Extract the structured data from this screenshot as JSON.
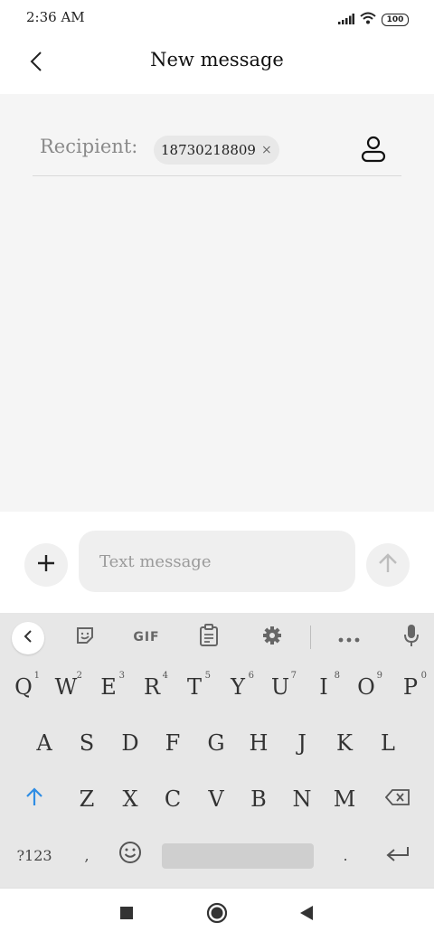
{
  "status_bar": {
    "time": "2:36 AM",
    "battery": "100",
    "icons": [
      "signal-icon",
      "wifi-icon",
      "battery-icon"
    ]
  },
  "header": {
    "title": "New message",
    "back_icon": "back-arrow-icon"
  },
  "recipient": {
    "label": "Recipient:",
    "chip_number": "18730218809",
    "chip_remove": "×",
    "contact_icon": "contact-icon"
  },
  "compose": {
    "placeholder": "Text message",
    "value": "",
    "add_icon": "plus-icon",
    "send_icon": "send-arrow-icon"
  },
  "keyboard": {
    "toolbar": {
      "gif_label": "GIF",
      "icons": [
        "collapse-icon",
        "sticker-icon",
        "gif-icon",
        "clipboard-icon",
        "settings-icon",
        "more-icon",
        "mic-icon"
      ]
    },
    "row1": [
      {
        "key": "Q",
        "hint": "1"
      },
      {
        "key": "W",
        "hint": "2"
      },
      {
        "key": "E",
        "hint": "3"
      },
      {
        "key": "R",
        "hint": "4"
      },
      {
        "key": "T",
        "hint": "5"
      },
      {
        "key": "Y",
        "hint": "6"
      },
      {
        "key": "U",
        "hint": "7"
      },
      {
        "key": "I",
        "hint": "8"
      },
      {
        "key": "O",
        "hint": "9"
      },
      {
        "key": "P",
        "hint": "0"
      }
    ],
    "row2": [
      "A",
      "S",
      "D",
      "F",
      "G",
      "H",
      "J",
      "K",
      "L"
    ],
    "row3": [
      "Z",
      "X",
      "C",
      "V",
      "B",
      "N",
      "M"
    ],
    "row4": {
      "symbols": "?123",
      "comma": ",",
      "period": "."
    },
    "accent_color": "#2f8de4"
  },
  "colors": {
    "background_main": "#f5f5f5",
    "keyboard_bg": "#e7e7e7",
    "label_gray": "#8a8a8a"
  }
}
